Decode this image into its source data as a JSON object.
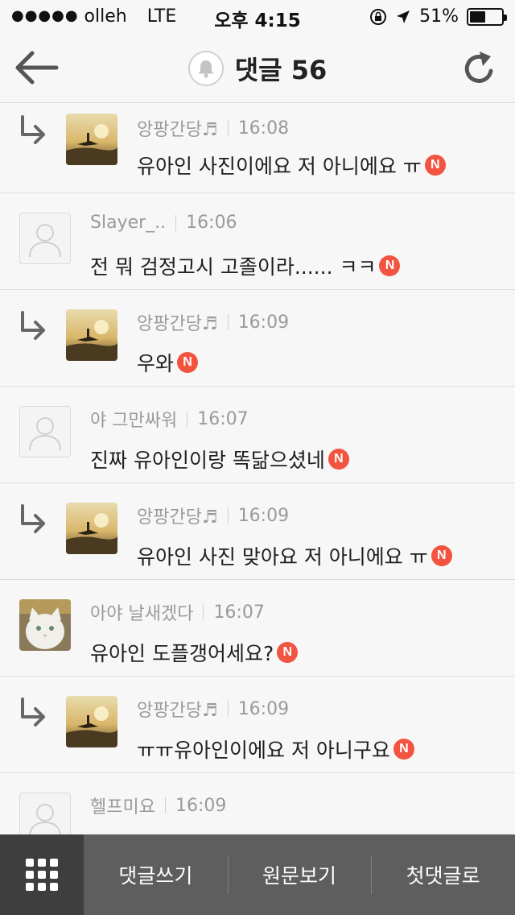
{
  "status_bar": {
    "signal": "●●●●●",
    "carrier": "olleh",
    "network": "LTE",
    "time": "오후 4:15",
    "battery": "51%",
    "battery_level": 0.51
  },
  "nav": {
    "title": "댓글 56"
  },
  "colors": {
    "badge": "#f2543f",
    "bottom_bar": "#5e5e5e",
    "grid_button": "#3e3e3e"
  },
  "badge_label": "N",
  "comments": [
    {
      "reply": true,
      "avatar": "sunset-photo",
      "author": "앙팡간당♬",
      "time": "16:08",
      "text": "유아인 사진이에요 저 아니에요 ㅠ",
      "is_new": true
    },
    {
      "reply": false,
      "avatar": "default-user",
      "author": "Slayer_..",
      "time": "16:06",
      "text": "전 뭐 검정고시 고졸이라...... ㅋㅋ",
      "is_new": true
    },
    {
      "reply": true,
      "avatar": "sunset-photo",
      "author": "앙팡간당♬",
      "time": "16:09",
      "text": "우와",
      "is_new": true
    },
    {
      "reply": false,
      "avatar": "default-user",
      "author": "야 그만싸워",
      "time": "16:07",
      "text": "진짜 유아인이랑 똑닮으셨네",
      "is_new": true
    },
    {
      "reply": true,
      "avatar": "sunset-photo",
      "author": "앙팡간당♬",
      "time": "16:09",
      "text": "유아인 사진 맞아요 저 아니에요 ㅠ",
      "is_new": true
    },
    {
      "reply": false,
      "avatar": "white-cat-photo",
      "author": "아야 날새겠다",
      "time": "16:07",
      "text": "유아인 도플갱어세요?",
      "is_new": true
    },
    {
      "reply": true,
      "avatar": "sunset-photo",
      "author": "앙팡간당♬",
      "time": "16:09",
      "text": "ㅠㅠ유아인이에요 저 아니구요",
      "is_new": true
    },
    {
      "reply": false,
      "avatar": "default-user",
      "author": "헬프미요",
      "time": "16:09",
      "text": "",
      "is_new": false
    }
  ],
  "bottom_bar": {
    "write_comment": "댓글쓰기",
    "view_original": "원문보기",
    "first_comment": "첫댓글로"
  }
}
